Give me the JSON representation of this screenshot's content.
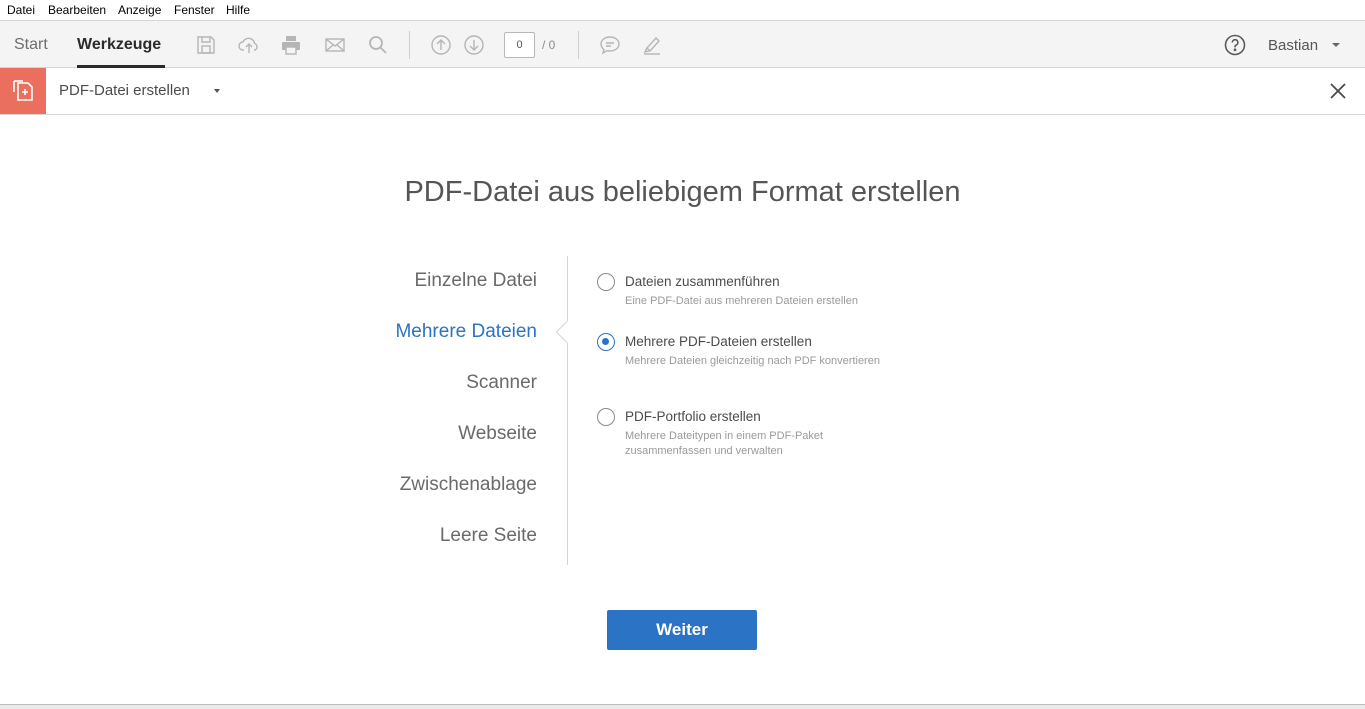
{
  "menubar": {
    "items": [
      {
        "label": "Datei"
      },
      {
        "label": "Bearbeiten"
      },
      {
        "label": "Anzeige"
      },
      {
        "label": "Fenster"
      },
      {
        "label": "Hilfe"
      }
    ]
  },
  "toolbar": {
    "start_label": "Start",
    "tools_label": "Werkzeuge",
    "icons": [
      "save-icon",
      "cloud-upload-icon",
      "print-icon",
      "mail-icon",
      "search-icon",
      "page-up-icon",
      "page-down-icon",
      "comment-icon",
      "highlight-pen-icon"
    ],
    "page_current": "0",
    "page_total": "/ 0",
    "help_icon": "help-icon",
    "user_name": "Bastian"
  },
  "tool_header": {
    "title": "PDF-Datei erstellen",
    "accent_color": "#ea6f5f"
  },
  "main": {
    "title": "PDF-Datei aus beliebigem Format erstellen",
    "categories": [
      {
        "label": "Einzelne Datei",
        "active": false
      },
      {
        "label": "Mehrere Dateien",
        "active": true
      },
      {
        "label": "Scanner",
        "active": false
      },
      {
        "label": "Webseite",
        "active": false
      },
      {
        "label": "Zwischenablage",
        "active": false
      },
      {
        "label": "Leere Seite",
        "active": false
      }
    ],
    "options": [
      {
        "label": "Dateien zusammenführen",
        "desc": "Eine PDF-Datei aus mehreren Dateien erstellen",
        "checked": false
      },
      {
        "label": "Mehrere PDF-Dateien erstellen",
        "desc": "Mehrere Dateien gleichzeitig nach PDF konvertieren",
        "checked": true
      },
      {
        "label": "PDF-Portfolio erstellen",
        "desc": "Mehrere Dateitypen in einem PDF-Paket zusammenfassen und verwalten",
        "checked": false
      }
    ],
    "continue_label": "Weiter",
    "accent_color": "#2b73c4"
  }
}
